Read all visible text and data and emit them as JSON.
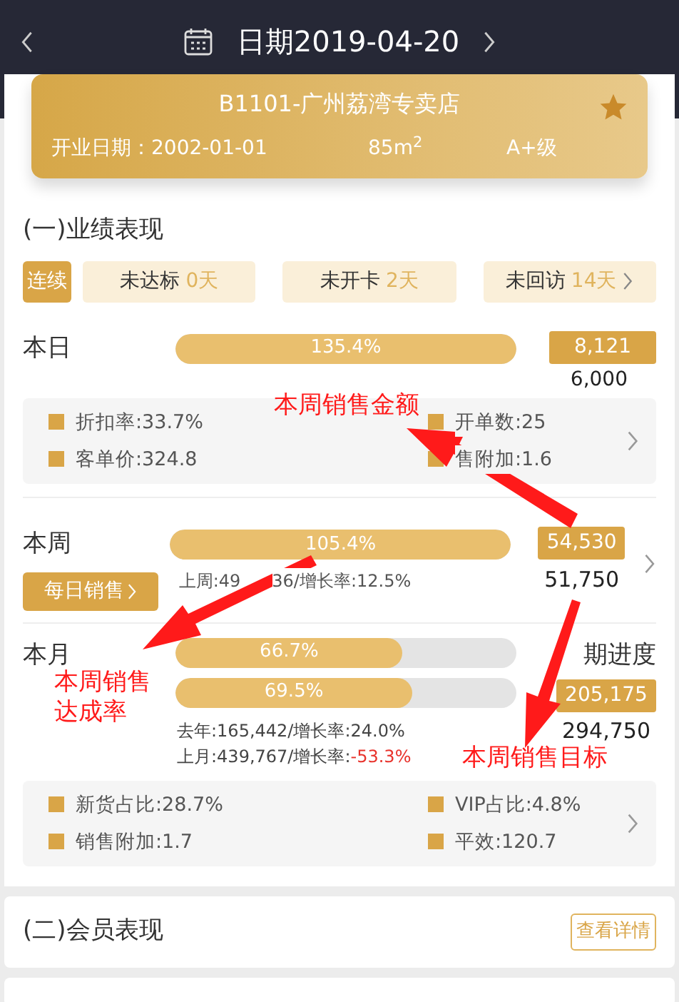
{
  "header": {
    "title": "日期2019-04-20"
  },
  "store": {
    "name": "B1101-广州荔湾专卖店",
    "open_date": "开业日期：2002-01-01",
    "area": "85m$^{2}$",
    "grade": "A+级",
    "starred": true
  },
  "performance": {
    "title": "(一)业绩表现",
    "streak_label": "连续",
    "streaks": [
      {
        "label": "未达标",
        "value": "0天"
      },
      {
        "label": "未开卡",
        "value": "2天"
      },
      {
        "label": "未回访",
        "value": "14天"
      }
    ],
    "day": {
      "label": "本日",
      "percent": "135.4%",
      "level": 1,
      "actual": "8,121",
      "target": "6,000",
      "metrics": [
        {
          "text": "折扣率:33.7%"
        },
        {
          "text": "开单数:25"
        },
        {
          "text": "客单价:324.8"
        },
        {
          "text": "售附加:1.6"
        }
      ]
    },
    "week": {
      "label": "本周",
      "percent": "105.4%",
      "level": 1,
      "actual": "54,530",
      "target": "51,750",
      "button": "每日销售",
      "compare_parts": [
        "上周:49",
        "36/增长率:12.5%"
      ]
    },
    "month": {
      "label": "本月",
      "bars": [
        {
          "percent": "66.7%",
          "level": 0.667
        },
        {
          "percent": "69.5%",
          "level": 0.695
        }
      ],
      "progress_label": "期进度",
      "actual": "205,175",
      "target": "294,750",
      "compare": [
        {
          "text": "去年:165,442/增长率:",
          "rate": "24.0%",
          "negative": false
        },
        {
          "text": "上月:439,767/增长率:",
          "rate": "-53.3%",
          "negative": true
        }
      ]
    },
    "metrics": [
      {
        "text": "新货占比:28.7%"
      },
      {
        "text": "VIP占比:4.8%"
      },
      {
        "text": "销售附加:1.7"
      },
      {
        "text": "平效:120.7"
      }
    ]
  },
  "members": {
    "title": "(二)会员表现",
    "button": "查看详情"
  },
  "annotations": [
    {
      "text": "本周销售金额"
    },
    {
      "text": "本周销售达成率"
    },
    {
      "text": "本周销售目标"
    }
  ]
}
